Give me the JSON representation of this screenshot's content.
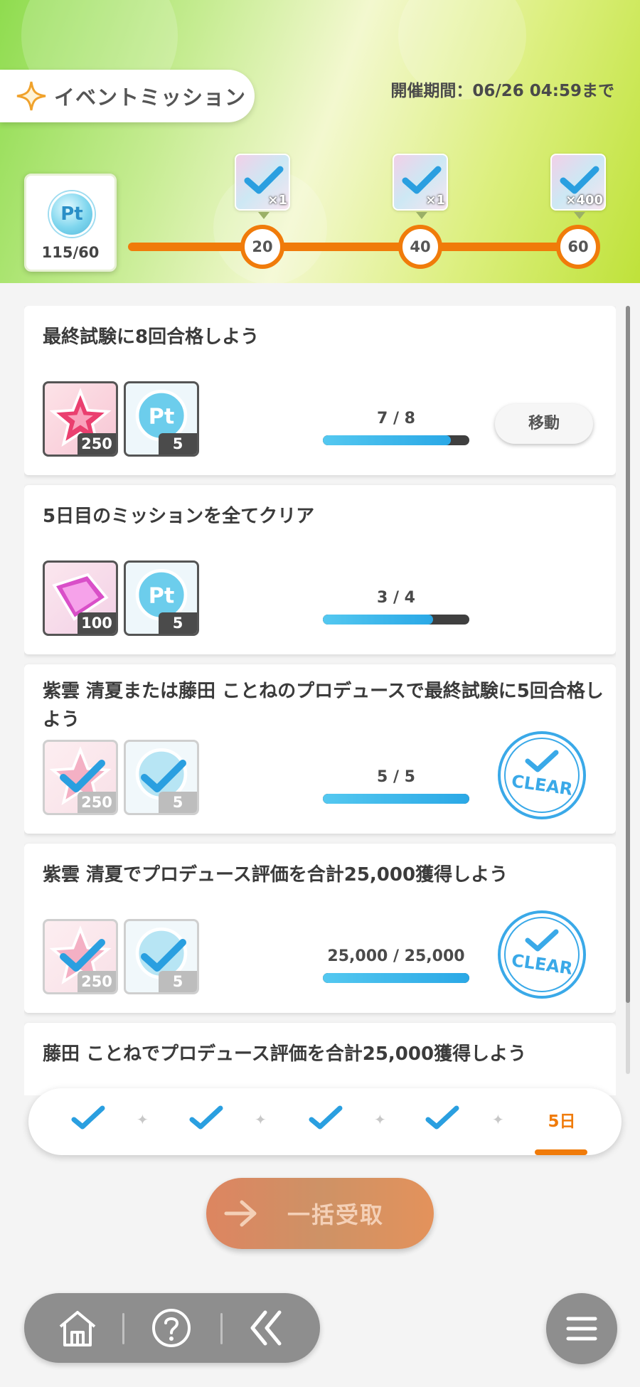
{
  "header": {
    "title": "イベントミッション",
    "period": "開催期間：06/26 04:59まで",
    "points": "115/60",
    "milestones": [
      {
        "value": "20",
        "qty": "×1"
      },
      {
        "value": "40",
        "qty": "×1"
      },
      {
        "value": "60",
        "qty": "×400"
      }
    ]
  },
  "missions": [
    {
      "title": "最終試験に8回合格しよう",
      "rewards": [
        "250",
        "5"
      ],
      "progress": "7 / 8",
      "fill": 0.875,
      "button": "移動",
      "cleared": false
    },
    {
      "title": "5日目のミッションを全てクリア",
      "rewards": [
        "100",
        "5"
      ],
      "progress": "3 / 4",
      "fill": 0.75,
      "cleared": false
    },
    {
      "title": "紫雲 清夏または藤田 ことねのプロデュースで最終試験に5回合格しよう",
      "rewards": [
        "250",
        "5"
      ],
      "progress": "5 / 5",
      "fill": 1.0,
      "cleared": true
    },
    {
      "title": "紫雲 清夏でプロデュース評価を合計25,000獲得しよう",
      "rewards": [
        "250",
        "5"
      ],
      "progress": "25,000 / 25,000",
      "fill": 1.0,
      "cleared": true
    },
    {
      "title": "藤田 ことねでプロデュース評価を合計25,000獲得しよう"
    }
  ],
  "days": {
    "active_label": "5日"
  },
  "clear_text": "CLEAR",
  "bulk_button": "一括受取",
  "colors": {
    "accent": "#f07b0a",
    "progress": "#2aa8e6",
    "clear_blue": "#3aa9e8"
  }
}
